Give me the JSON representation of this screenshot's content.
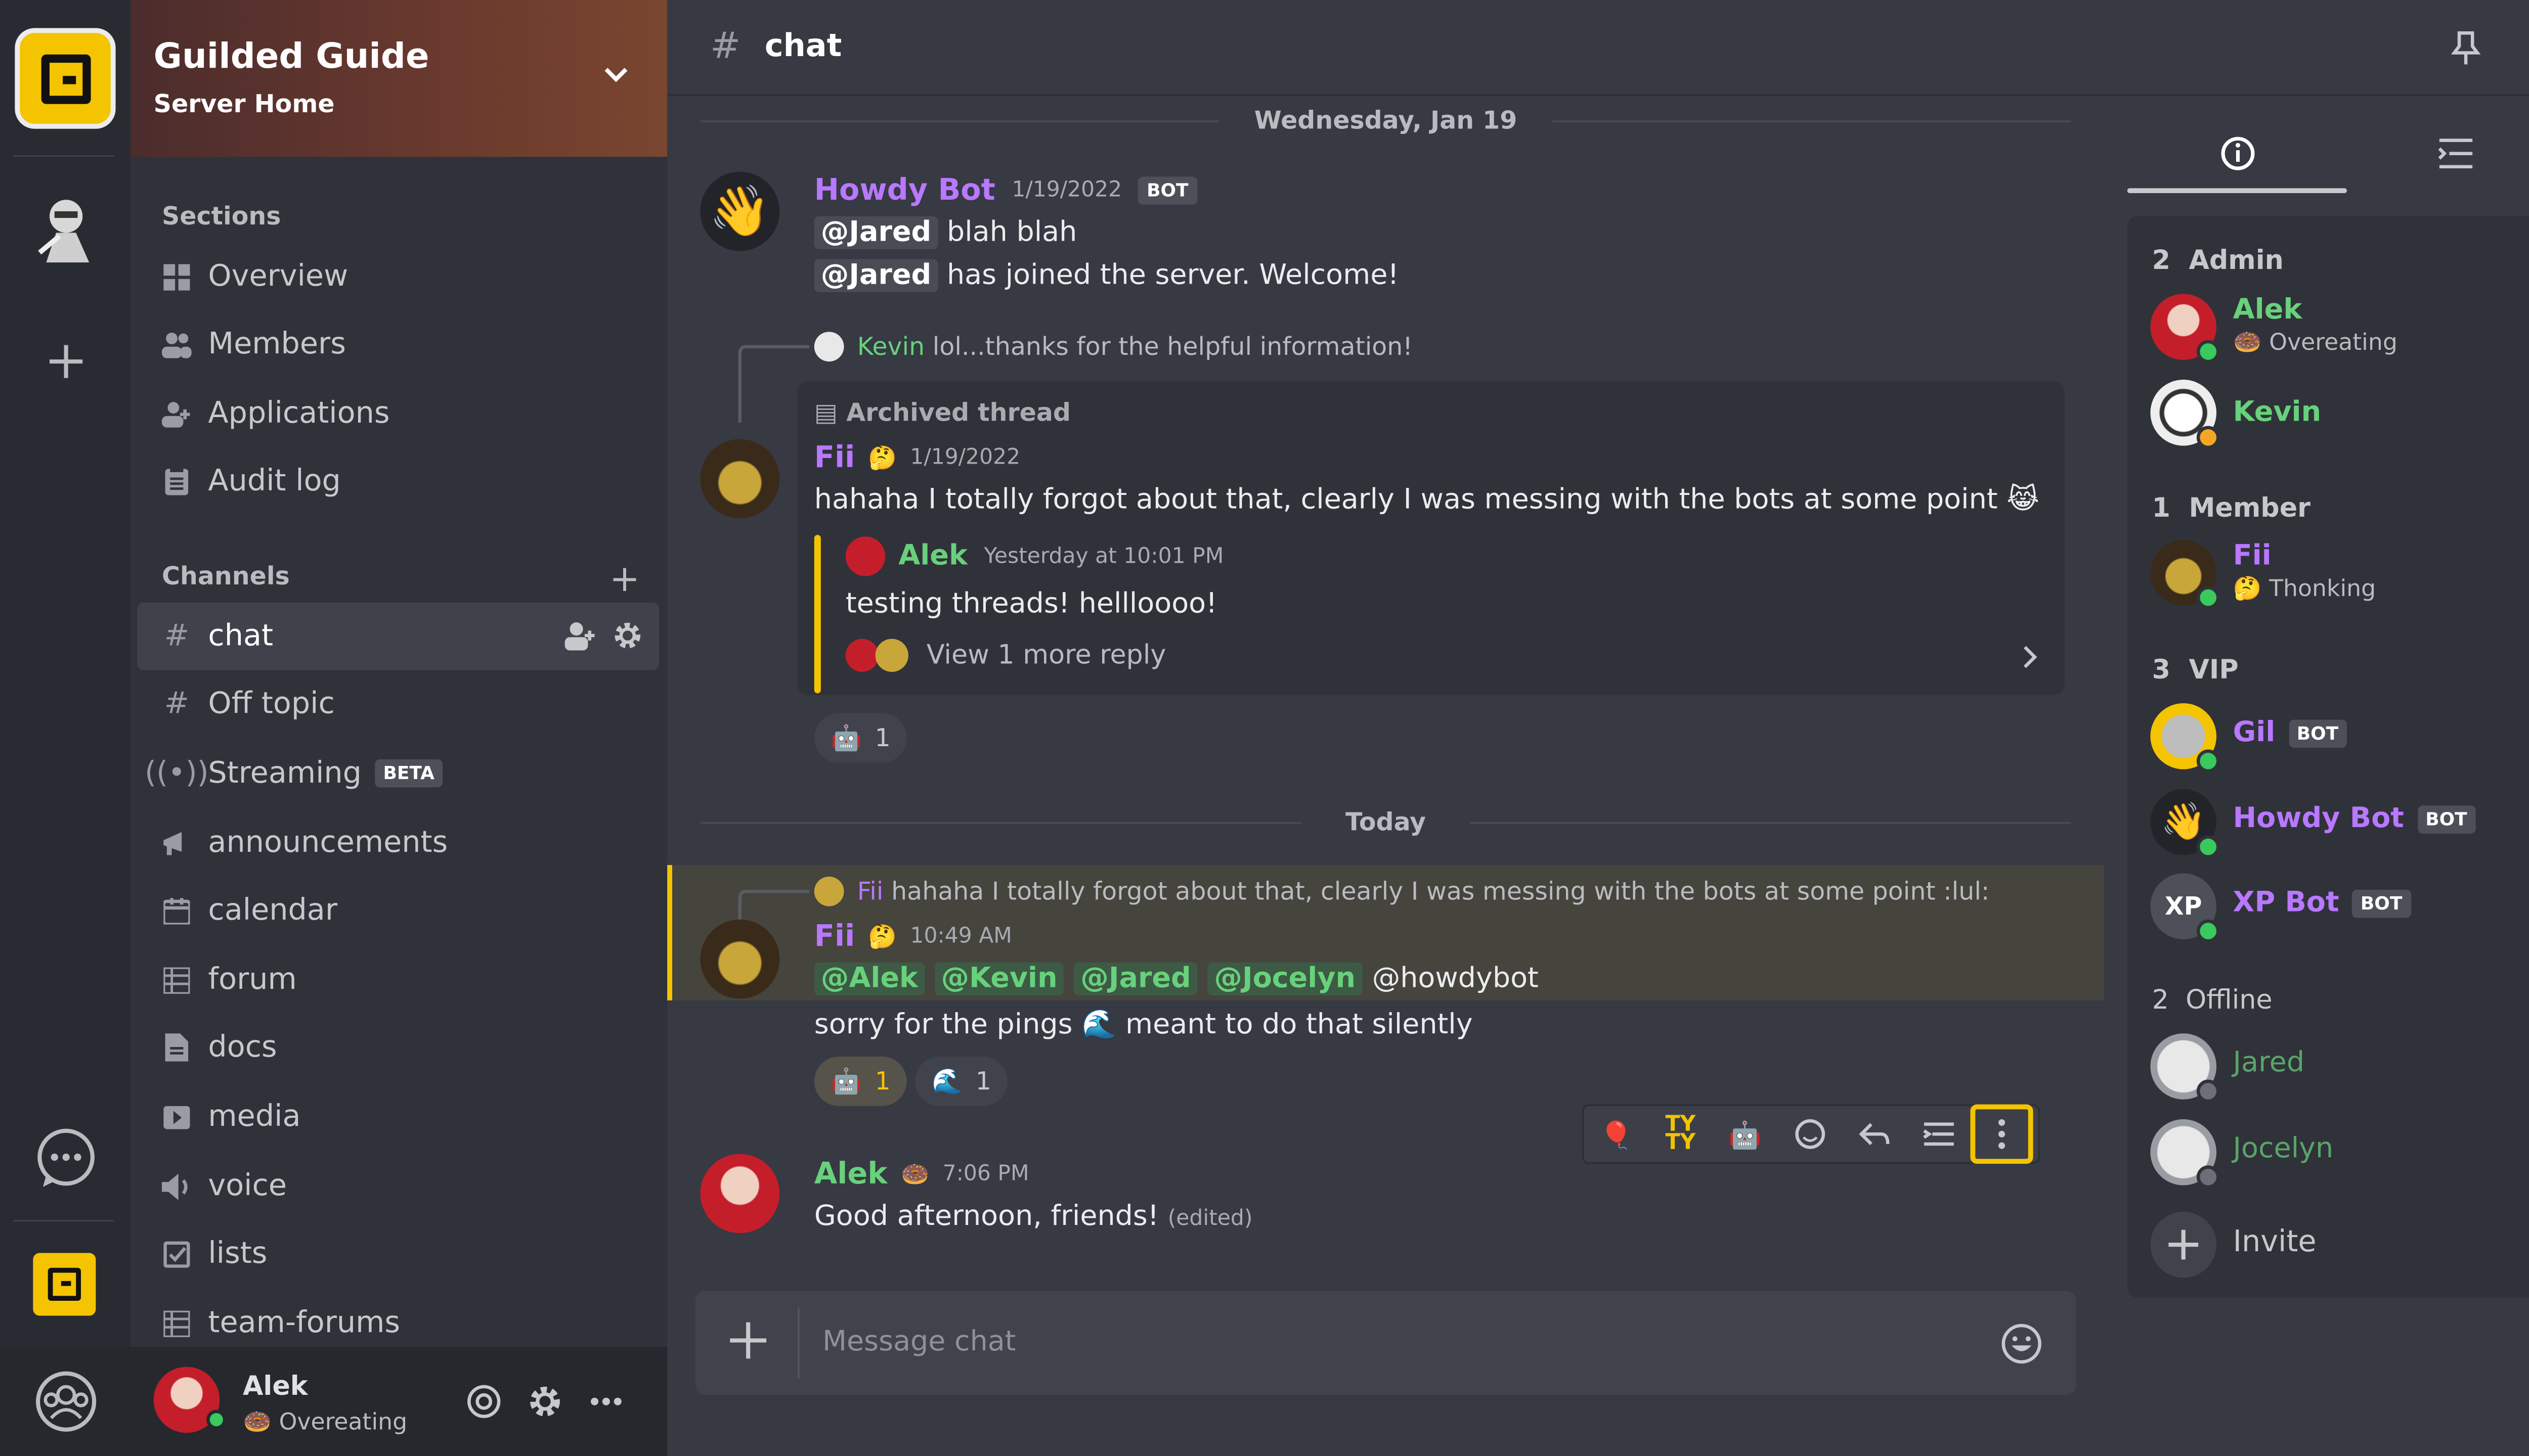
{
  "server": {
    "name": "Guilded Guide",
    "subtitle": "Server Home"
  },
  "sections": {
    "title": "Sections",
    "items": [
      {
        "label": "Overview",
        "icon": "grid-icon"
      },
      {
        "label": "Members",
        "icon": "members-icon"
      },
      {
        "label": "Applications",
        "icon": "applications-icon"
      },
      {
        "label": "Audit log",
        "icon": "audit-log-icon"
      }
    ]
  },
  "channels": {
    "title": "Channels",
    "items": [
      {
        "label": "chat",
        "icon": "hash-icon",
        "active": true
      },
      {
        "label": "Off topic",
        "icon": "hash-icon"
      },
      {
        "label": "Streaming",
        "icon": "broadcast-icon",
        "badge": "BETA"
      },
      {
        "label": "announcements",
        "icon": "megaphone-icon"
      },
      {
        "label": "calendar",
        "icon": "calendar-icon"
      },
      {
        "label": "forum",
        "icon": "forum-icon"
      },
      {
        "label": "docs",
        "icon": "doc-icon"
      },
      {
        "label": "media",
        "icon": "media-icon"
      },
      {
        "label": "voice",
        "icon": "speaker-icon"
      },
      {
        "label": "lists",
        "icon": "checkbox-icon"
      },
      {
        "label": "team-forums",
        "icon": "forum-icon"
      }
    ]
  },
  "user": {
    "name": "Alek",
    "status": "🍩 Overeating"
  },
  "topbar": {
    "channel": "chat"
  },
  "dividers": {
    "first": "Wednesday, Jan 19",
    "second": "Today"
  },
  "messages": {
    "howdy": {
      "author": "Howdy Bot",
      "time": "1/19/2022",
      "badge": "BOT",
      "line1_mention": "@Jared",
      "line1_text": "blah blah",
      "line2_mention": "@Jared",
      "line2_text": "has joined the server. Welcome!"
    },
    "fii1": {
      "reply_author": "Kevin",
      "reply_text": "lol...thanks for the helpful information!",
      "thread_label": "Archived thread",
      "author": "Fii",
      "emoji": "🤔",
      "time": "1/19/2022",
      "text": "hahaha I totally forgot about that, clearly I was messing with the bots at some point",
      "nested_author": "Alek",
      "nested_time": "Yesterday at 10:01 PM",
      "nested_text": "testing threads! hellloooo!",
      "more_replies": "View 1 more reply",
      "reaction_count": "1"
    },
    "fii2": {
      "reply_author": "Fii",
      "reply_text": "hahaha I totally forgot about that, clearly I was messing with the bots at some point :lul:",
      "author": "Fii",
      "emoji": "🤔",
      "time": "10:49 AM",
      "mentions": [
        "@Alek",
        "@Kevin",
        "@Jared",
        "@Jocelyn"
      ],
      "plain_mention": "@howdybot",
      "text1": "sorry for the pings",
      "text2": "meant to do that silently",
      "reaction1_count": "1",
      "reaction2_count": "1"
    },
    "alek": {
      "author": "Alek",
      "emoji": "🍩",
      "time": "7:06 PM",
      "text": "Good afternoon, friends!",
      "edited": "(edited)"
    }
  },
  "composer": {
    "placeholder": "Message chat"
  },
  "members": {
    "groups": [
      {
        "count": "2",
        "label": "Admin"
      },
      {
        "count": "1",
        "label": "Member"
      },
      {
        "count": "3",
        "label": "VIP"
      },
      {
        "count": "2",
        "label": "Offline"
      }
    ],
    "list": [
      {
        "name": "Alek",
        "status": "🍩 Overeating",
        "color": "#68d17b"
      },
      {
        "name": "Kevin",
        "status": "",
        "color": "#68d17b"
      },
      {
        "name": "Fii",
        "status": "🤔 Thonking",
        "color": "#b878ff"
      },
      {
        "name": "Gil",
        "badge": "BOT",
        "color": "#b878ff"
      },
      {
        "name": "Howdy Bot",
        "badge": "BOT",
        "color": "#b878ff"
      },
      {
        "name": "XP Bot",
        "badge": "BOT",
        "color": "#b878ff"
      },
      {
        "name": "Jared",
        "color": "#5aa46a"
      },
      {
        "name": "Jocelyn",
        "color": "#5aa46a"
      }
    ],
    "invite": "Invite"
  },
  "colors": {
    "accent": "#f5c400",
    "admin": "#68d17b",
    "vip": "#b878ff"
  }
}
